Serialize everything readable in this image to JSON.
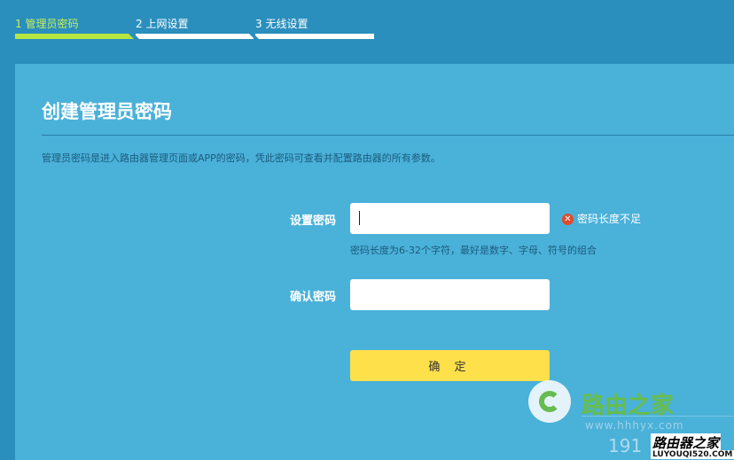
{
  "steps": [
    {
      "label": "1 管理员密码",
      "active": true
    },
    {
      "label": "2 上网设置",
      "active": false
    },
    {
      "label": "3 无线设置",
      "active": false
    }
  ],
  "page": {
    "title": "创建管理员密码",
    "description": "管理员密码是进入路由器管理页面或APP的密码，凭此密码可查看并配置路由器的所有参数。"
  },
  "form": {
    "password_label": "设置密码",
    "password_value": "",
    "error_text": "密码长度不足",
    "hint": "密码长度为6-32个字符，最好是数字、字母、符号的组合",
    "confirm_label": "确认密码",
    "confirm_value": "",
    "submit_label": "确 定"
  },
  "watermark": {
    "cn": "路由之家",
    "site": "www.hhhyx.com",
    "num": "191",
    "brand": "路由器之家",
    "url": "LUYOUQI520.COM"
  },
  "colors": {
    "background": "#2a8fbd",
    "panel": "#4ab1d9",
    "active_step": "#b6e63f",
    "button": "#fde04a",
    "error": "#e04a2a"
  }
}
